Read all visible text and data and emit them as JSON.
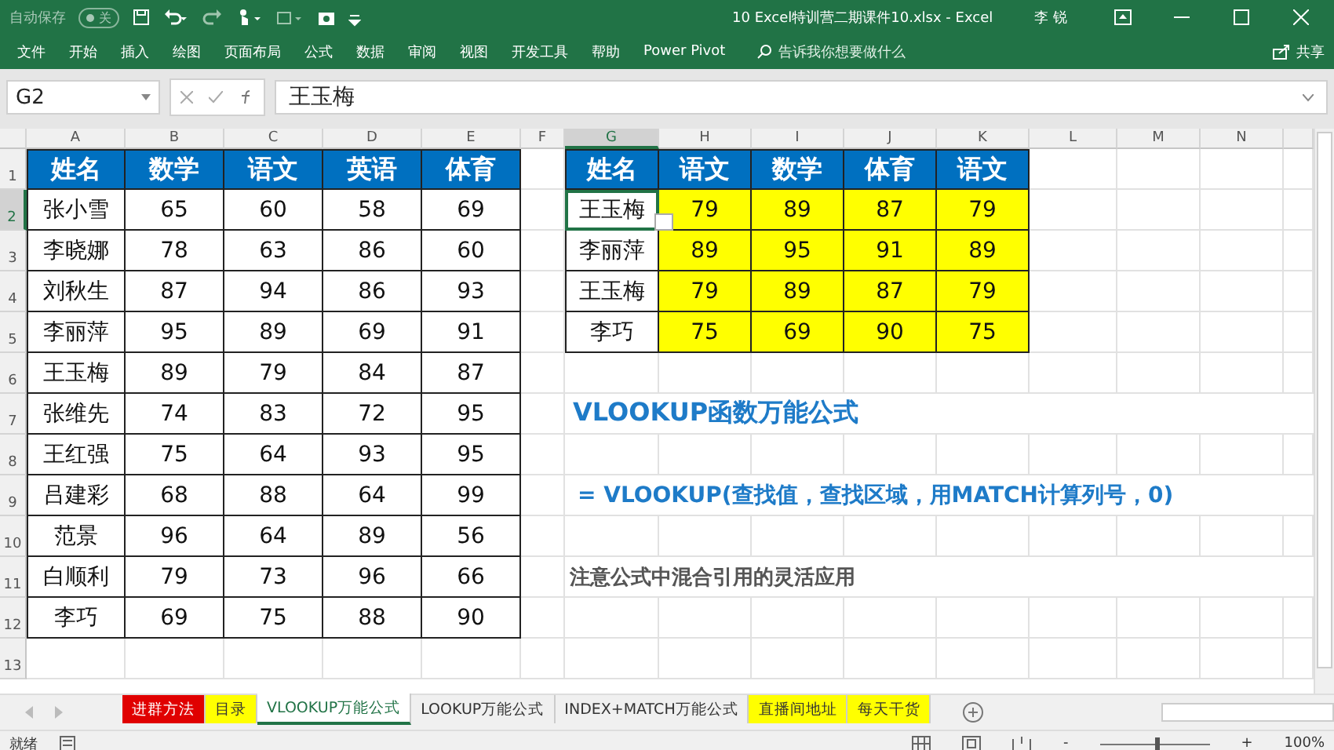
{
  "title_bar": {
    "autosave": {
      "label": "自动保存",
      "on": false,
      "state_text": "关"
    },
    "title": "10 Excel特训营二期课件10.xlsx  -  Excel",
    "user": "李 锐"
  },
  "menu": {
    "items": [
      "文件",
      "开始",
      "插入",
      "绘图",
      "页面布局",
      "公式",
      "数据",
      "审阅",
      "视图",
      "开发工具",
      "帮助",
      "Power Pivot"
    ],
    "search": {
      "placeholder": "告诉我你想要做什么"
    },
    "share": "共享"
  },
  "formula_bar": {
    "name_box": "G2",
    "value": "王玉梅"
  },
  "sheet": {
    "columns": [
      {
        "label": "A",
        "selected": false
      },
      {
        "label": "B",
        "selected": false
      },
      {
        "label": "C",
        "selected": false
      },
      {
        "label": "D",
        "selected": false
      },
      {
        "label": "E",
        "selected": false
      },
      {
        "label": "F",
        "selected": false
      },
      {
        "label": "G",
        "selected": true
      },
      {
        "label": "H",
        "selected": false
      },
      {
        "label": "I",
        "selected": false
      },
      {
        "label": "J",
        "selected": false
      },
      {
        "label": "K",
        "selected": false
      },
      {
        "label": "L",
        "selected": false
      },
      {
        "label": "M",
        "selected": false
      },
      {
        "label": "N",
        "selected": false
      }
    ],
    "rows": [
      {
        "label": "1",
        "selected": false
      },
      {
        "label": "2",
        "selected": true
      },
      {
        "label": "3",
        "selected": false
      },
      {
        "label": "4",
        "selected": false
      },
      {
        "label": "5",
        "selected": false
      },
      {
        "label": "6",
        "selected": false
      },
      {
        "label": "7",
        "selected": false
      },
      {
        "label": "8",
        "selected": false
      },
      {
        "label": "9",
        "selected": false
      },
      {
        "label": "10",
        "selected": false
      },
      {
        "label": "11",
        "selected": false
      },
      {
        "label": "12",
        "selected": false
      },
      {
        "label": "13",
        "selected": false
      }
    ],
    "left_table": {
      "columns": [
        "姓名",
        "数学",
        "语文",
        "英语",
        "体育"
      ],
      "rows": [
        [
          "张小雪",
          "65",
          "60",
          "58",
          "69"
        ],
        [
          "李晓娜",
          "78",
          "63",
          "86",
          "60"
        ],
        [
          "刘秋生",
          "87",
          "94",
          "86",
          "93"
        ],
        [
          "李丽萍",
          "95",
          "89",
          "69",
          "91"
        ],
        [
          "王玉梅",
          "89",
          "79",
          "84",
          "87"
        ],
        [
          "张维先",
          "74",
          "83",
          "72",
          "95"
        ],
        [
          "王红强",
          "75",
          "64",
          "93",
          "95"
        ],
        [
          "吕建彩",
          "68",
          "88",
          "64",
          "99"
        ],
        [
          "范景",
          "96",
          "64",
          "89",
          "56"
        ],
        [
          "白顺利",
          "79",
          "73",
          "96",
          "66"
        ],
        [
          "李巧",
          "69",
          "75",
          "88",
          "90"
        ]
      ]
    },
    "right_table": {
      "columns": [
        "姓名",
        "语文",
        "数学",
        "体育",
        "语文"
      ],
      "rows": [
        [
          "王玉梅",
          "79",
          "89",
          "87",
          "79"
        ],
        [
          "李丽萍",
          "89",
          "95",
          "91",
          "89"
        ],
        [
          "王玉梅",
          "79",
          "89",
          "87",
          "79"
        ],
        [
          "李巧",
          "75",
          "69",
          "90",
          "75"
        ]
      ]
    },
    "notes": [
      {
        "kind": "title",
        "text": "VLOOKUP函数万能公式"
      },
      {
        "kind": "formula",
        "text": "= VLOOKUP(查找值，查找区域，用MATCH计算列号，0)"
      },
      {
        "kind": "note",
        "text": "注意公式中混合引用的灵活应用"
      }
    ]
  },
  "sheet_tabs": [
    {
      "label": "进群方法",
      "selected": false,
      "color": "#e00000"
    },
    {
      "label": "目录",
      "selected": false,
      "color": "#ffff00"
    },
    {
      "label": "VLOOKUP万能公式",
      "selected": true
    },
    {
      "label": "LOOKUP万能公式",
      "selected": false
    },
    {
      "label": "INDEX+MATCH万能公式",
      "selected": false
    },
    {
      "label": "直播间地址",
      "selected": false,
      "color": "#ffff00"
    },
    {
      "label": "每天干货",
      "selected": false,
      "color": "#ffff00"
    }
  ],
  "status_bar": {
    "status": "就绪",
    "zoom_out": "-",
    "zoom_in": "+",
    "zoom": "100%",
    "level": 0.5
  }
}
